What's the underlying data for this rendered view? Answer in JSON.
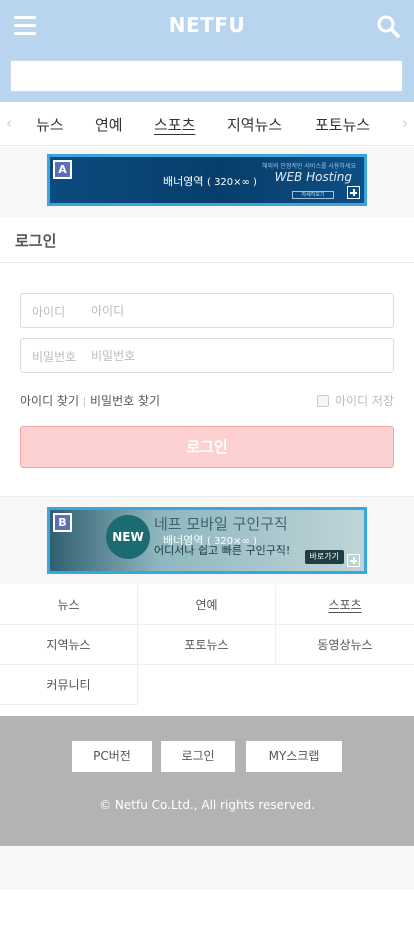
{
  "header": {
    "title": "NETFU",
    "search_placeholder": "",
    "menu_icon": "hamburger-icon",
    "search_icon": "search-icon",
    "bg_color": "#b9d4ee"
  },
  "nav": {
    "tabs": [
      {
        "label": "뉴스"
      },
      {
        "label": "연예"
      },
      {
        "label": "스포츠",
        "active": true
      },
      {
        "label": "지역뉴스"
      },
      {
        "label": "포토뉴스"
      }
    ],
    "left_arrow": "‹",
    "right_arrow": "›"
  },
  "banner_a": {
    "badge": "A",
    "label": "배너영역",
    "size": "( 320×∞ )",
    "sub_text": "해외의 안정적인 서비스를 사용하세요",
    "main_text": "WEB Hosting",
    "button_text": "자세히보기"
  },
  "login": {
    "title": "로그인",
    "id_label": "아이디",
    "id_placeholder": "아이디",
    "pw_label": "비밀번호",
    "pw_placeholder": "비밀번호",
    "find_id": "아이디 찾기",
    "find_pw": "비밀번호 찾기",
    "save_id": "아이디 저장",
    "submit": "로그인",
    "submit_color": "#fdd1d1"
  },
  "banner_b": {
    "badge": "B",
    "new_label": "NEW",
    "title": "네프 모바일 구인구직",
    "label": "배너영역",
    "size": "( 320×∞ )",
    "sub_text": "어디서나 쉽고 빠른 구인구직!",
    "button_text": "바로가기"
  },
  "menu": {
    "items": [
      "뉴스",
      "연예",
      "스포츠",
      "지역뉴스",
      "포토뉴스",
      "동영상뉴스",
      "커뮤니티"
    ]
  },
  "footer": {
    "buttons": [
      "PC버전",
      "로그인",
      "MY스크랩"
    ],
    "copyright": "© Netfu Co.Ltd., All rights reserved.",
    "bg_color": "#b3b3b3"
  }
}
